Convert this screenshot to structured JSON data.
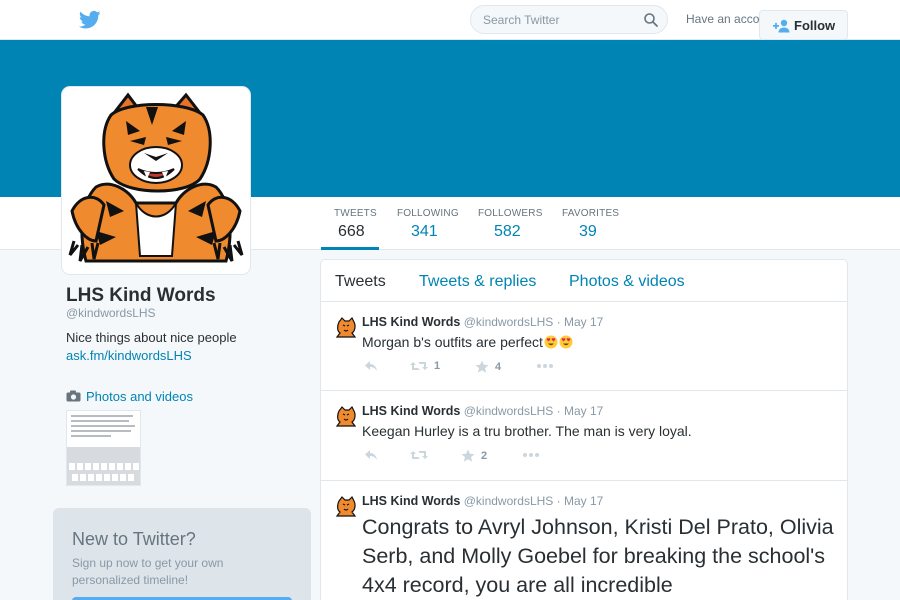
{
  "search": {
    "placeholder": "Search Twitter"
  },
  "account": {
    "login_text": "Have an account? Log in"
  },
  "colors": {
    "brand": "#0084b4",
    "banner": "#0084b4",
    "link": "#0084b4",
    "muted": "#8899a6"
  },
  "stats": [
    {
      "label": "TWEETS",
      "value": "668"
    },
    {
      "label": "FOLLOWING",
      "value": "341"
    },
    {
      "label": "FOLLOWERS",
      "value": "582"
    },
    {
      "label": "FAVORITES",
      "value": "39"
    }
  ],
  "follow": {
    "label": "Follow"
  },
  "profile": {
    "name": "LHS Kind Words",
    "handle": "@kindwordsLHS",
    "bio": "Nice things about nice people",
    "link": "ask.fm/kindwordsLHS",
    "photos_label": "Photos and videos"
  },
  "signup": {
    "title": "New to Twitter?",
    "text": "Sign up now to get your own personalized timeline!"
  },
  "timeline": {
    "tabs": [
      "Tweets",
      "Tweets & replies",
      "Photos & videos"
    ]
  },
  "tweets": [
    {
      "name": "LHS Kind Words",
      "handle": "@kindwordsLHS",
      "date": "· May 17",
      "text": "Morgan b's outfits are perfect",
      "retweets": "1",
      "favorites": "4"
    },
    {
      "name": "LHS Kind Words",
      "handle": "@kindwordsLHS",
      "date": "· May 17",
      "text": "Keegan Hurley is a tru brother. The man is very loyal.",
      "retweets": "",
      "favorites": "2"
    },
    {
      "name": "LHS Kind Words",
      "handle": "@kindwordsLHS",
      "date": "· May 17",
      "text": "Congrats to Avryl Johnson, Kristi Del Prato, Olivia Serb, and Molly Goebel for breaking the school's 4x4 record, you are all incredible"
    }
  ]
}
